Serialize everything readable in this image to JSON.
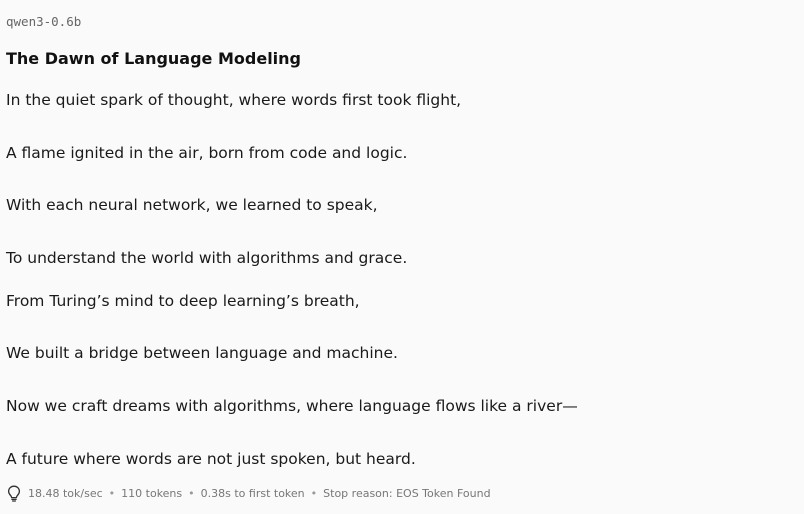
{
  "model": {
    "name": "qwen3-0.6b"
  },
  "message": {
    "title": "The Dawn of Language Modeling",
    "lines": [
      "In the quiet spark of thought, where words first took flight,",
      "A flame ignited in the air, born from code and logic.",
      "With each neural network, we learned to speak,",
      "To understand the world with algorithms and grace.",
      "From Turing’s mind to deep learning’s breath,",
      "We built a bridge between language and machine.",
      "Now we craft dreams with algorithms, where language flows like a river—",
      "A future where words are not just spoken, but heard."
    ]
  },
  "stats": {
    "icon": "lightbulb-icon",
    "speed": "18.48 tok/sec",
    "tokens": "110 tokens",
    "first_token": "0.38s to first token",
    "stop_reason": "Stop reason: EOS Token Found",
    "separator": "•"
  }
}
